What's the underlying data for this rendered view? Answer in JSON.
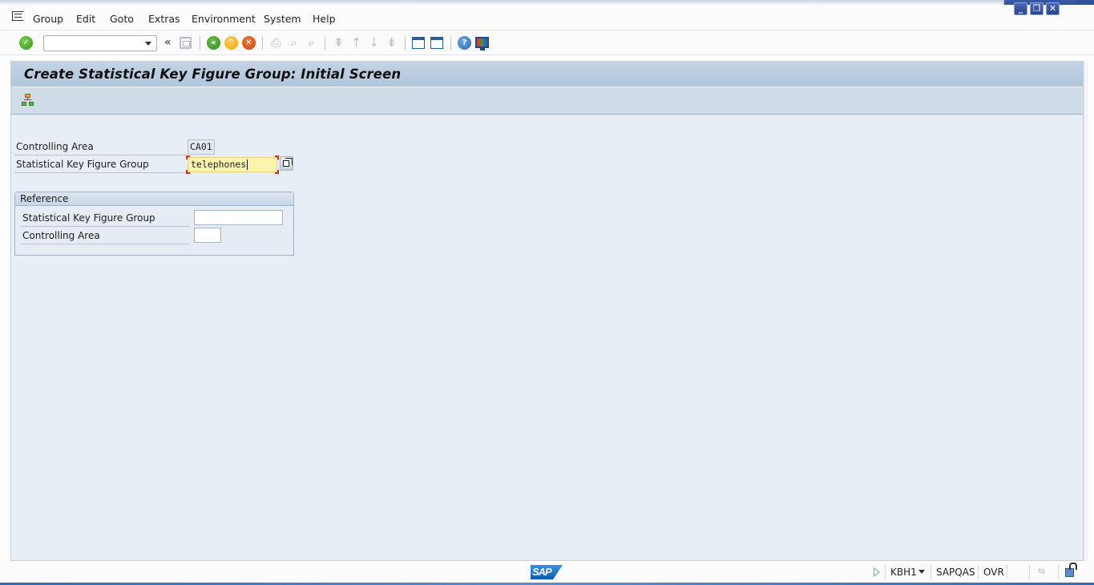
{
  "window": {
    "controls": {
      "minimize": "_",
      "restore": "❐",
      "close": "✕"
    }
  },
  "menubar": {
    "items": [
      {
        "label": "Group"
      },
      {
        "label": "Edit"
      },
      {
        "label": "Goto"
      },
      {
        "label": "Extras"
      },
      {
        "label": "Environment"
      },
      {
        "label": "System"
      },
      {
        "label": "Help"
      }
    ]
  },
  "toolbar": {
    "command_field": {
      "value": "",
      "placeholder": ""
    },
    "icons": {
      "enter": "check-icon",
      "collapse": "«",
      "save": "save-icon",
      "back": "«",
      "exit": "⌃",
      "cancel": "✕",
      "print": "print-icon",
      "find": "find-icon",
      "find_next": "find-next-icon",
      "first_page": "first-page-icon",
      "prev_page": "previous-page-icon",
      "next_page": "next-page-icon",
      "last_page": "last-page-icon",
      "new_session": "new-session-icon",
      "shortcut": "shortcut-icon",
      "help": "?",
      "layout": "customize-layout-icon"
    }
  },
  "page": {
    "title": "Create Statistical Key Figure Group: Initial Screen",
    "app_toolbar": {
      "hierarchy_icon": "hierarchy-icon"
    }
  },
  "form": {
    "controlling_area": {
      "label": "Controlling Area",
      "value": "CA01"
    },
    "skf_group": {
      "label": "Statistical Key Figure Group",
      "value": "telephones"
    }
  },
  "reference": {
    "title": "Reference",
    "skf_group": {
      "label": "Statistical Key Figure Group",
      "value": ""
    },
    "controlling_area": {
      "label": "Controlling Area",
      "value": ""
    }
  },
  "statusbar": {
    "logo": "SAP",
    "transaction": "KBH1",
    "system": "SAPQAS",
    "mode": "OVR"
  }
}
